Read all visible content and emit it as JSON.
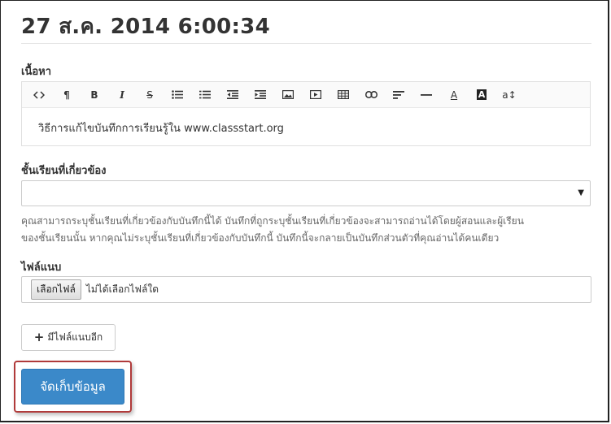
{
  "header": {
    "title": "27 ส.ค. 2014 6:00:34"
  },
  "content": {
    "label": "เนื้อหา",
    "toolbar": [
      {
        "icon": "code-icon",
        "glyph": "<>"
      },
      {
        "icon": "pilcrow-icon",
        "glyph": "¶"
      },
      {
        "icon": "bold-icon",
        "glyph": "B"
      },
      {
        "icon": "italic-icon",
        "glyph": "I"
      },
      {
        "icon": "strikethrough-icon",
        "glyph": "S"
      },
      {
        "icon": "unordered-list-icon",
        "glyph": ""
      },
      {
        "icon": "ordered-list-icon",
        "glyph": ""
      },
      {
        "icon": "outdent-icon",
        "glyph": ""
      },
      {
        "icon": "indent-icon",
        "glyph": ""
      },
      {
        "icon": "image-icon",
        "glyph": ""
      },
      {
        "icon": "video-icon",
        "glyph": ""
      },
      {
        "icon": "table-icon",
        "glyph": ""
      },
      {
        "icon": "link-icon",
        "glyph": ""
      },
      {
        "icon": "align-icon",
        "glyph": ""
      },
      {
        "icon": "horizontal-rule-icon",
        "glyph": ""
      },
      {
        "icon": "font-color-icon",
        "glyph": "A"
      },
      {
        "icon": "background-color-icon",
        "glyph": "A"
      },
      {
        "icon": "font-size-icon",
        "glyph": "a↕"
      }
    ],
    "text": "วิธีการแก้ไขบันทึกการเรียนรู้ใน www.classstart.org"
  },
  "related_class": {
    "label": "ชั้นเรียนที่เกี่ยวข้อง",
    "selected": "",
    "arrow": "▼",
    "help_line1": "คุณสามารถระบุชั้นเรียนที่เกี่ยวข้องกับบันทึกนี้ได้ บันทึกที่ถูกระบุชั้นเรียนที่เกี่ยวข้องจะสามารถอ่านได้โดยผู้สอนและผู้เรียน",
    "help_line2": "ของชั้นเรียนนั้น หากคุณไม่ระบุชั้นเรียนที่เกี่ยวข้องกับบันทึกนี้ บันทึกนี้จะกลายเป็นบันทึกส่วนตัวที่คุณอ่านได้คนเดียว"
  },
  "attachment": {
    "label": "ไฟล์แนบ",
    "choose_button": "เลือกไฟล์",
    "no_file": "ไม่ได้เลือกไฟล์ใด",
    "add_more_plus": "+",
    "add_more": "มีไฟล์แนบอีก"
  },
  "save_button": "จัดเก็บข้อมูล"
}
